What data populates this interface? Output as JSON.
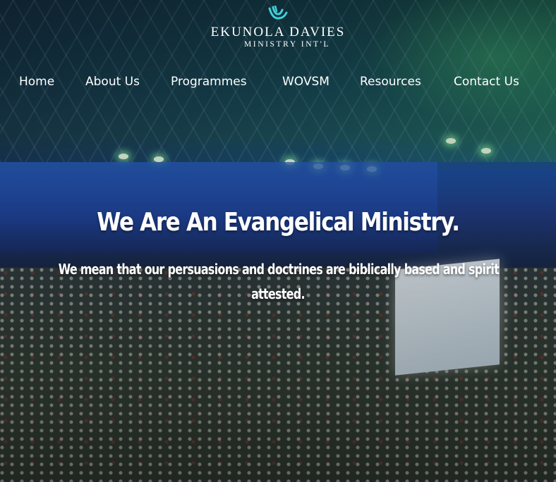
{
  "brand": {
    "name": "EKUNOLA DAVIES",
    "subtitle": "MINISTRY INT'L",
    "logo_icon": "hands-wave-logo-icon",
    "accent": "#3fd0d9"
  },
  "nav": {
    "items": [
      {
        "label": "Home"
      },
      {
        "label": "About Us"
      },
      {
        "label": "Programmes"
      },
      {
        "label": "WOVSM"
      },
      {
        "label": "Resources"
      },
      {
        "label": "Contact Us"
      }
    ]
  },
  "hero": {
    "headline": "We Are An Evangelical Ministry.",
    "subtext_line1": "We mean that our persuasions and doctrines are biblically based and spirit",
    "subtext_line2": "attested."
  }
}
